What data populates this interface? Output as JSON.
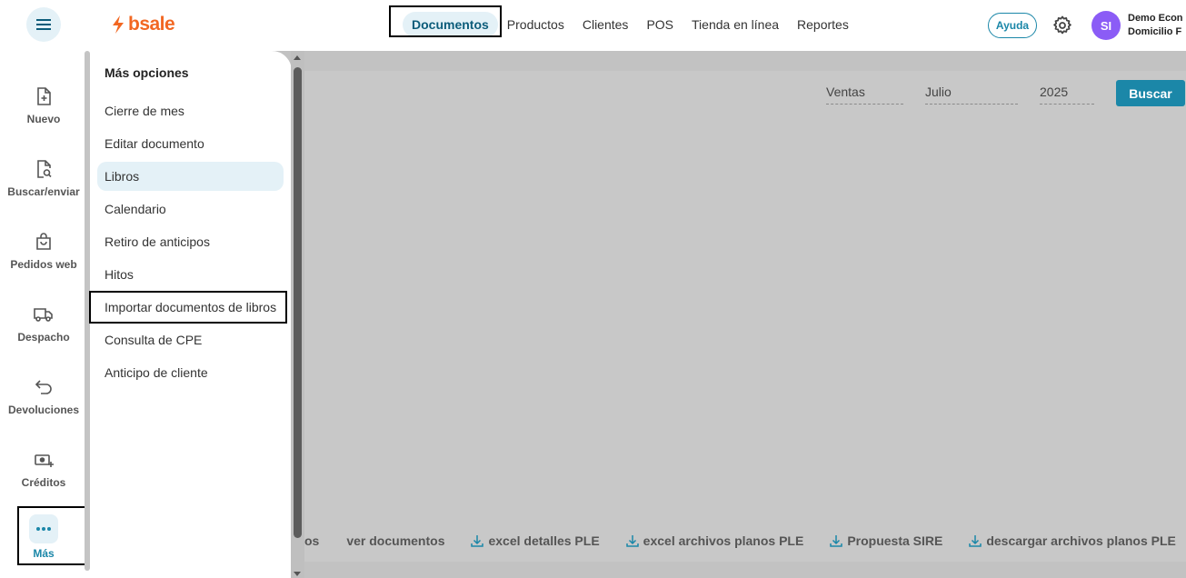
{
  "header": {
    "logo_text": "bsale",
    "nav": [
      "Documentos",
      "Productos",
      "Clientes",
      "POS",
      "Tienda en línea",
      "Reportes"
    ],
    "help_label": "Ayuda",
    "avatar_initials": "SI",
    "user_line1": "Demo Econ",
    "user_line2": "Domicilio F"
  },
  "sidebar": {
    "items": [
      {
        "label": "Nuevo",
        "icon": "file-plus-icon"
      },
      {
        "label": "Buscar/enviar",
        "icon": "file-search-icon"
      },
      {
        "label": "Pedidos web",
        "icon": "shopping-bag-icon"
      },
      {
        "label": "Despacho",
        "icon": "truck-icon"
      },
      {
        "label": "Devoluciones",
        "icon": "undo-arrow-icon"
      },
      {
        "label": "Créditos",
        "icon": "cash-plus-icon"
      },
      {
        "label": "Más",
        "icon": "more-dots-icon"
      }
    ]
  },
  "panel": {
    "title": "Más opciones",
    "items": [
      "Cierre de mes",
      "Editar documento",
      "Libros",
      "Calendario",
      "Retiro de anticipos",
      "Hitos",
      "Importar documentos de libros",
      "Consulta de CPE",
      "Anticipo de cliente"
    ]
  },
  "filters": {
    "type": "Ventas",
    "month": "Julio",
    "year": "2025",
    "search_label": "Buscar"
  },
  "actions": {
    "partial": "os",
    "items": [
      "ver documentos",
      "excel detalles PLE",
      "excel archivos planos PLE",
      "Propuesta SIRE",
      "descargar archivos planos PLE"
    ]
  },
  "colors": {
    "accent": "#1b87a8",
    "brand": "#f26722",
    "avatar": "#8b5cf6",
    "overlay": "#c2c2c2"
  }
}
